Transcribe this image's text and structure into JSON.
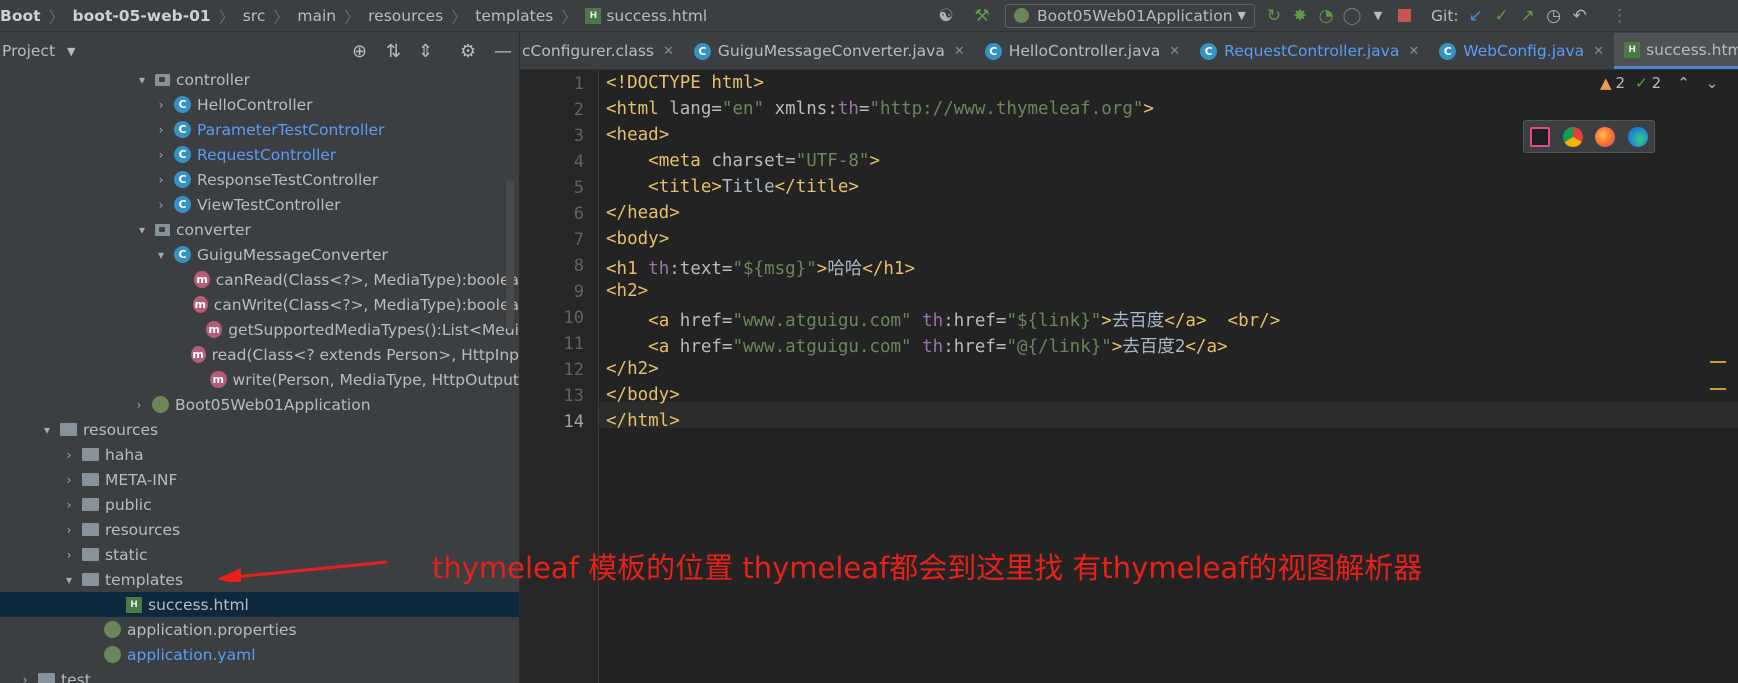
{
  "breadcrumb": [
    "Boot",
    "boot-05-web-01",
    "src",
    "main",
    "resources",
    "templates",
    "success.html"
  ],
  "run_config": "Boot05Web01Application",
  "git_label": "Git:",
  "project_panel": {
    "title": "Project"
  },
  "tree": [
    {
      "label": "controller",
      "type": "package",
      "indent": 155,
      "arrow": "▾"
    },
    {
      "label": "HelloController",
      "type": "class",
      "indent": 174,
      "arrow": "›"
    },
    {
      "label": "ParameterTestController",
      "type": "class",
      "indent": 174,
      "arrow": "›",
      "blue": true
    },
    {
      "label": "RequestController",
      "type": "class",
      "indent": 174,
      "arrow": "›",
      "blue": true
    },
    {
      "label": "ResponseTestController",
      "type": "class",
      "indent": 174,
      "arrow": "›"
    },
    {
      "label": "ViewTestController",
      "type": "class",
      "indent": 174,
      "arrow": "›"
    },
    {
      "label": "converter",
      "type": "package",
      "indent": 155,
      "arrow": "▾"
    },
    {
      "label": "GuiguMessageConverter",
      "type": "class",
      "indent": 174,
      "arrow": "▾"
    },
    {
      "label": "canRead(Class<?>, MediaType):boolea",
      "type": "method",
      "indent": 216,
      "arrow": ""
    },
    {
      "label": "canWrite(Class<?>, MediaType):boolea",
      "type": "method",
      "indent": 216,
      "arrow": ""
    },
    {
      "label": "getSupportedMediaTypes():List<Medi",
      "type": "method",
      "indent": 216,
      "arrow": ""
    },
    {
      "label": "read(Class<? extends Person>, HttpInp",
      "type": "method",
      "indent": 216,
      "arrow": ""
    },
    {
      "label": "write(Person, MediaType, HttpOutput",
      "type": "method",
      "indent": 216,
      "arrow": ""
    },
    {
      "label": "Boot05Web01Application",
      "type": "spring",
      "indent": 152,
      "arrow": "›"
    },
    {
      "label": "resources",
      "type": "folder",
      "indent": 60,
      "arrow": "▾"
    },
    {
      "label": "haha",
      "type": "folder",
      "indent": 82,
      "arrow": "›"
    },
    {
      "label": "META-INF",
      "type": "folder",
      "indent": 82,
      "arrow": "›"
    },
    {
      "label": "public",
      "type": "folder",
      "indent": 82,
      "arrow": "›"
    },
    {
      "label": "resources",
      "type": "folder",
      "indent": 82,
      "arrow": "›"
    },
    {
      "label": "static",
      "type": "folder",
      "indent": 82,
      "arrow": "›"
    },
    {
      "label": "templates",
      "type": "folder",
      "indent": 82,
      "arrow": "▾"
    },
    {
      "label": "success.html",
      "type": "html",
      "indent": 126,
      "arrow": "",
      "selected": true
    },
    {
      "label": "application.properties",
      "type": "spring",
      "indent": 104,
      "arrow": ""
    },
    {
      "label": "application.yaml",
      "type": "spring",
      "indent": 104,
      "arrow": "",
      "blue": true
    },
    {
      "label": "test",
      "type": "folder",
      "indent": 38,
      "arrow": "›"
    }
  ],
  "tabs": [
    {
      "label": "cConfigurer.class",
      "icon": "",
      "active": false
    },
    {
      "label": "GuiguMessageConverter.java",
      "icon": "C",
      "active": false
    },
    {
      "label": "HelloController.java",
      "icon": "C",
      "active": false
    },
    {
      "label": "RequestController.java",
      "icon": "C",
      "active": false,
      "blue": true
    },
    {
      "label": "WebConfig.java",
      "icon": "C",
      "active": false,
      "blue": true
    },
    {
      "label": "success.html",
      "icon": "H",
      "active": true
    }
  ],
  "inspection": {
    "warnings": "2",
    "weak": "2"
  },
  "code_lines": [
    "1",
    "2",
    "3",
    "4",
    "5",
    "6",
    "7",
    "8",
    "9",
    "10",
    "11",
    "12",
    "13",
    "14"
  ],
  "code": {
    "l1": "<!DOCTYPE html>",
    "l2_a": "html",
    "l2_b": " lang=",
    "l2_c": "\"en\"",
    "l2_d": " xmlns:",
    "l2_e": "th",
    "l2_f": "=",
    "l2_g": "\"http://www.thymeleaf.org\"",
    "l3": "head",
    "l4_a": "meta",
    "l4_b": " charset=",
    "l4_c": "\"UTF-8\"",
    "l5_a": "title",
    "l5_b": "Title",
    "l6": "head",
    "l7": "body",
    "l8_a": "h1",
    "l8_b": "th",
    "l8_c": ":text=",
    "l8_d": "\"${msg}\"",
    "l8_e": "哈哈",
    "l9": "h2",
    "l10_a": "a",
    "l10_b": " href=",
    "l10_c": "\"www.atguigu.com\"",
    "l10_d": "th",
    "l10_e": ":href=",
    "l10_f": "\"${link}\"",
    "l10_g": "去百度",
    "l10_h": "br",
    "l11_a": "a",
    "l11_b": " href=",
    "l11_c": "\"www.atguigu.com\"",
    "l11_d": "th",
    "l11_e": ":href=",
    "l11_f": "\"@{/link}\"",
    "l11_g": "去百度2",
    "l12": "h2",
    "l13": "body",
    "l14": "html"
  },
  "annotation": "thymeleaf 模板的位置  thymeleaf都会到这里找 有thymeleaf的视图解析器",
  "colors": {
    "annotation": "#e8201a",
    "tag": "#e8bf6a",
    "attr_value": "#6a8759",
    "namespace": "#9876aa"
  }
}
